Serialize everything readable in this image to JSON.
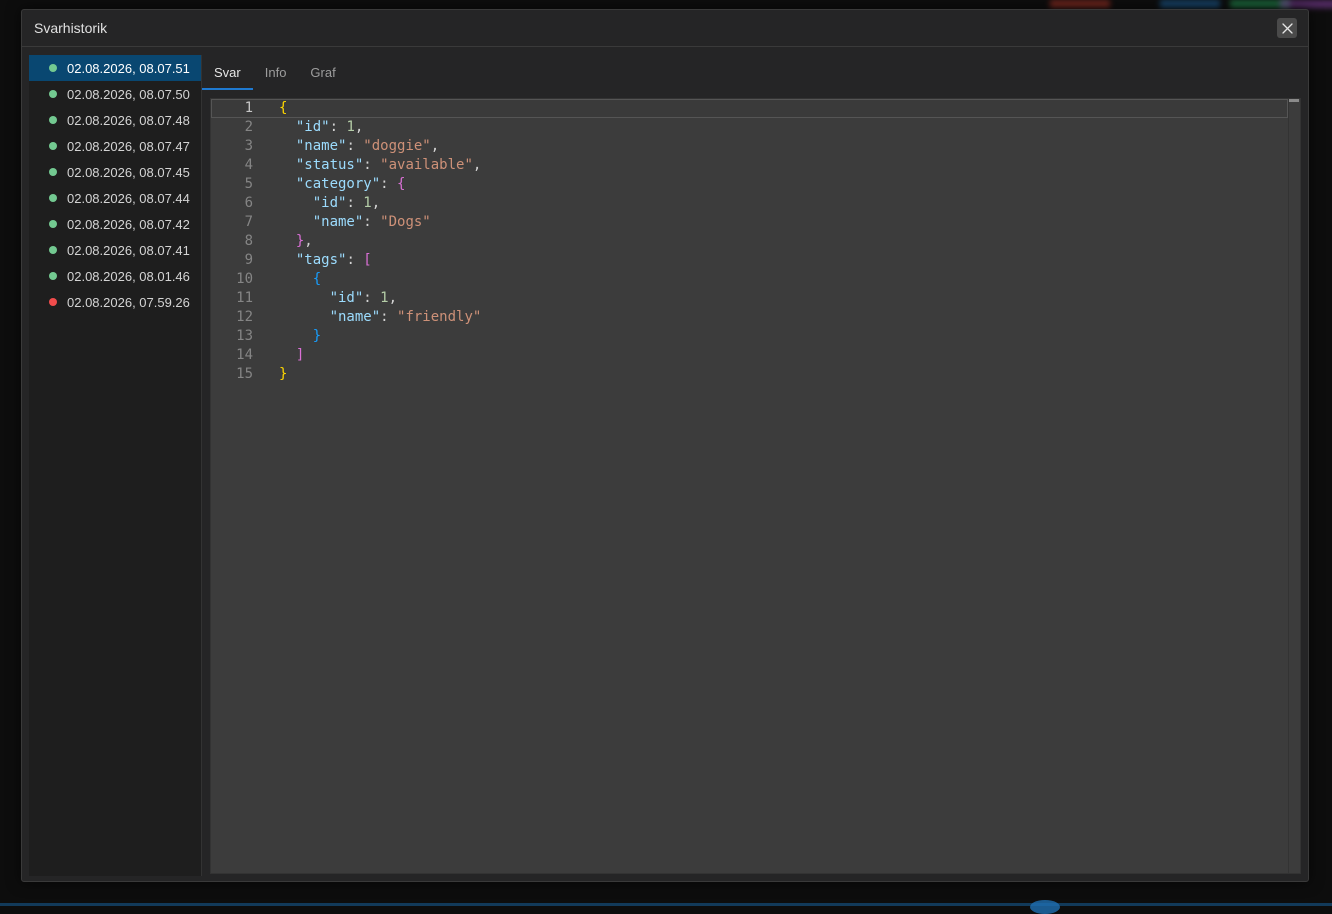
{
  "window": {
    "title": "Svarhistorik",
    "close_icon": "close-icon"
  },
  "history": [
    {
      "label": "02.08.2026, 08.07.51",
      "status": "ok",
      "color": "#73c991",
      "active": true
    },
    {
      "label": "02.08.2026, 08.07.50",
      "status": "ok",
      "color": "#73c991"
    },
    {
      "label": "02.08.2026, 08.07.48",
      "status": "ok",
      "color": "#73c991"
    },
    {
      "label": "02.08.2026, 08.07.47",
      "status": "ok",
      "color": "#73c991"
    },
    {
      "label": "02.08.2026, 08.07.45",
      "status": "ok",
      "color": "#73c991"
    },
    {
      "label": "02.08.2026, 08.07.44",
      "status": "ok",
      "color": "#73c991"
    },
    {
      "label": "02.08.2026, 08.07.42",
      "status": "ok",
      "color": "#73c991"
    },
    {
      "label": "02.08.2026, 08.07.41",
      "status": "ok",
      "color": "#73c991"
    },
    {
      "label": "02.08.2026, 08.01.46",
      "status": "ok",
      "color": "#73c991"
    },
    {
      "label": "02.08.2026, 07.59.26",
      "status": "error",
      "color": "#f14c4c"
    }
  ],
  "tabs": [
    {
      "label": "Svar",
      "active": true
    },
    {
      "label": "Info"
    },
    {
      "label": "Graf"
    }
  ],
  "editor": {
    "language": "json",
    "lines": [
      [
        [
          "b1",
          "{"
        ]
      ],
      [
        [
          "p",
          "  "
        ],
        [
          "k",
          "\"id\""
        ],
        [
          "p",
          ": "
        ],
        [
          "n",
          "1"
        ],
        [
          "p",
          ","
        ]
      ],
      [
        [
          "p",
          "  "
        ],
        [
          "k",
          "\"name\""
        ],
        [
          "p",
          ": "
        ],
        [
          "s",
          "\"doggie\""
        ],
        [
          "p",
          ","
        ]
      ],
      [
        [
          "p",
          "  "
        ],
        [
          "k",
          "\"status\""
        ],
        [
          "p",
          ": "
        ],
        [
          "s",
          "\"available\""
        ],
        [
          "p",
          ","
        ]
      ],
      [
        [
          "p",
          "  "
        ],
        [
          "k",
          "\"category\""
        ],
        [
          "p",
          ": "
        ],
        [
          "b2",
          "{"
        ]
      ],
      [
        [
          "p",
          "    "
        ],
        [
          "k",
          "\"id\""
        ],
        [
          "p",
          ": "
        ],
        [
          "n",
          "1"
        ],
        [
          "p",
          ","
        ]
      ],
      [
        [
          "p",
          "    "
        ],
        [
          "k",
          "\"name\""
        ],
        [
          "p",
          ": "
        ],
        [
          "s",
          "\"Dogs\""
        ]
      ],
      [
        [
          "p",
          "  "
        ],
        [
          "b2",
          "}"
        ],
        [
          "p",
          ","
        ]
      ],
      [
        [
          "p",
          "  "
        ],
        [
          "k",
          "\"tags\""
        ],
        [
          "p",
          ": "
        ],
        [
          "b2",
          "["
        ]
      ],
      [
        [
          "p",
          "    "
        ],
        [
          "b3",
          "{"
        ]
      ],
      [
        [
          "p",
          "      "
        ],
        [
          "k",
          "\"id\""
        ],
        [
          "p",
          ": "
        ],
        [
          "n",
          "1"
        ],
        [
          "p",
          ","
        ]
      ],
      [
        [
          "p",
          "      "
        ],
        [
          "k",
          "\"name\""
        ],
        [
          "p",
          ": "
        ],
        [
          "s",
          "\"friendly\""
        ]
      ],
      [
        [
          "p",
          "    "
        ],
        [
          "b3",
          "}"
        ]
      ],
      [
        [
          "p",
          "  "
        ],
        [
          "b2",
          "]"
        ]
      ],
      [
        [
          "b1",
          "}"
        ]
      ]
    ]
  }
}
